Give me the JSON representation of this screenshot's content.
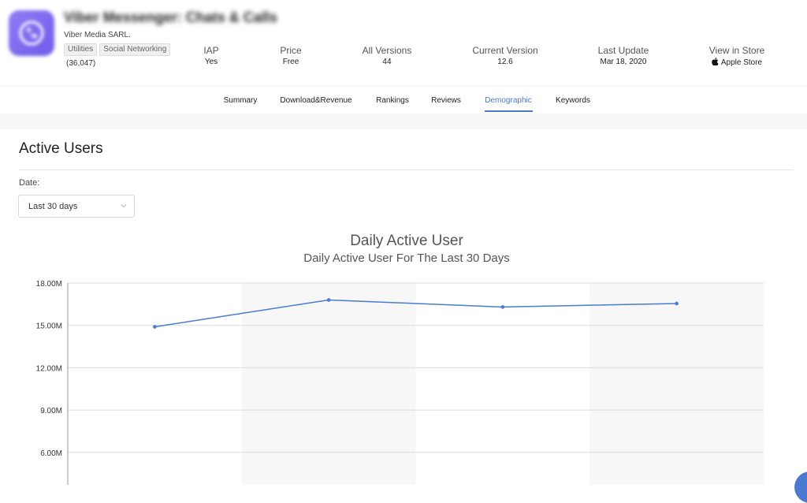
{
  "app": {
    "title": "Viber Messenger: Chats & Calls",
    "developer": "Viber Media SARL.",
    "tags": [
      "Utilities",
      "Social Networking"
    ],
    "rating_count": "(36,047)"
  },
  "meta": [
    {
      "label": "IAP",
      "value": "Yes"
    },
    {
      "label": "Price",
      "value": "Free"
    },
    {
      "label": "All Versions",
      "value": "44"
    },
    {
      "label": "Current Version",
      "value": "12.6"
    },
    {
      "label": "Last Update",
      "value": "Mar 18, 2020"
    },
    {
      "label": "View in Store",
      "value": "Apple Store"
    }
  ],
  "tabs": [
    "Summary",
    "Download&Revenue",
    "Rankings",
    "Reviews",
    "Demographic",
    "Keywords"
  ],
  "active_tab": "Demographic",
  "section": {
    "title": "Active Users",
    "date_label": "Date:",
    "date_value": "Last 30 days"
  },
  "colors": {
    "accent": "#4a7bd0",
    "app_icon": "#7b68ee"
  },
  "icons": {
    "app_icon": "viber-phone-icon",
    "store": "apple-icon",
    "dropdown": "chevron-down-icon"
  },
  "chart_data": {
    "type": "line",
    "title": "Daily Active User",
    "subtitle": "Daily Active User For The Last 30 Days",
    "y_ticks": [
      "18.00M",
      "15.00M",
      "12.00M",
      "9.00M",
      "6.00M"
    ],
    "ylim_visible": [
      6000000,
      18000000
    ],
    "series": [
      {
        "values": [
          14900000,
          16800000,
          16300000,
          16550000
        ]
      }
    ],
    "grid": true,
    "alternating_bands": true
  }
}
